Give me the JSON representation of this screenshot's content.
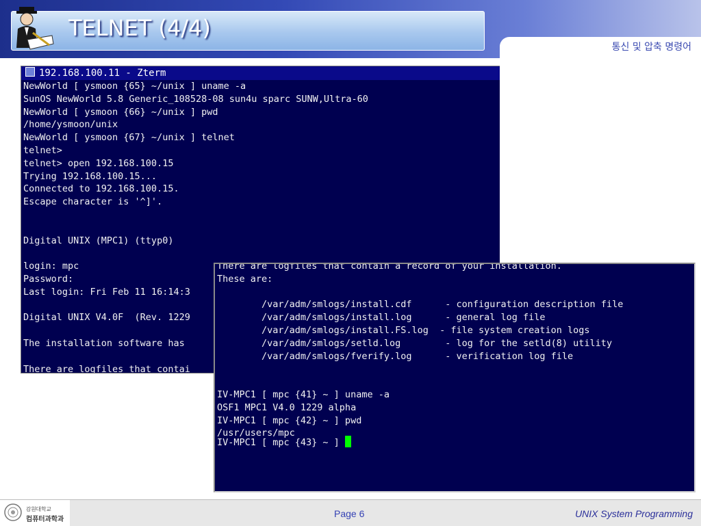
{
  "slide": {
    "title": "TELNET (4/4)",
    "subtitle": "통신 및 압축 명령어",
    "logo_icon": "person-writing-icon"
  },
  "terminal_main": {
    "title": "192.168.100.11 - Zterm",
    "lines": [
      "NewWorld [ ysmoon {65} ~/unix ] uname -a",
      "SunOS NewWorld 5.8 Generic_108528-08 sun4u sparc SUNW,Ultra-60",
      "NewWorld [ ysmoon {66} ~/unix ] pwd",
      "/home/ysmoon/unix",
      "NewWorld [ ysmoon {67} ~/unix ] telnet",
      "telnet>",
      "telnet> open 192.168.100.15",
      "Trying 192.168.100.15...",
      "Connected to 192.168.100.15.",
      "Escape character is '^]'.",
      "",
      "",
      "Digital UNIX (MPC1) (ttyp0)",
      "",
      "login: mpc",
      "Password:",
      "Last login: Fri Feb 11 16:14:3",
      "",
      "Digital UNIX V4.0F  (Rev. 1229",
      "",
      "The installation software has",
      "",
      "There are logfiles that contai"
    ]
  },
  "terminal_overlay": {
    "lines": [
      "There are logfiles that contain a record of your installation.",
      "These are:",
      "",
      "        /var/adm/smlogs/install.cdf      - configuration description file",
      "        /var/adm/smlogs/install.log      - general log file",
      "        /var/adm/smlogs/install.FS.log  - file system creation logs",
      "        /var/adm/smlogs/setld.log        - log for the setld(8) utility",
      "        /var/adm/smlogs/fverify.log      - verification log file",
      "",
      "",
      "IV-MPC1 [ mpc {41} ~ ] uname -a",
      "OSF1 MPC1 V4.0 1229 alpha",
      "IV-MPC1 [ mpc {42} ~ ] pwd",
      "/usr/users/mpc"
    ],
    "prompt": "IV-MPC1 [ mpc {43} ~ ] "
  },
  "footer": {
    "logo_small": "강원대학교",
    "logo_main": "컴퓨터과학과",
    "page": "Page 6",
    "course": "UNIX System Programming"
  },
  "colors": {
    "terminal_bg": "#000050",
    "cursor": "#00ff00",
    "header_blue": "#1d2f8c"
  }
}
